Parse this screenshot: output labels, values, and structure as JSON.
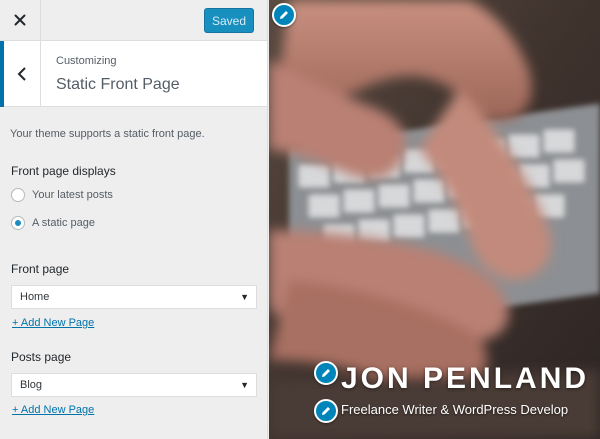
{
  "topbar": {
    "close_icon": "close-icon",
    "saved_label": "Saved"
  },
  "section": {
    "back_icon": "chevron-left-icon",
    "kicker": "Customizing",
    "title": "Static Front Page"
  },
  "panel": {
    "description": "Your theme supports a static front page.",
    "front_page_displays": {
      "label": "Front page displays",
      "options": [
        {
          "label": "Your latest posts",
          "checked": false
        },
        {
          "label": "A static page",
          "checked": true
        }
      ]
    },
    "front_page": {
      "label": "Front page",
      "value": "Home",
      "add_link": "+ Add New Page"
    },
    "posts_page": {
      "label": "Posts page",
      "value": "Blog",
      "add_link": "+ Add New Page"
    }
  },
  "preview": {
    "site_title": "JON PENLAND",
    "tagline": "Freelance Writer & WordPress Develop",
    "edit_icon": "pencil-icon"
  },
  "colors": {
    "accent": "#0085ba",
    "link": "#0073aa",
    "sidebar_bg": "#eeeeee"
  }
}
